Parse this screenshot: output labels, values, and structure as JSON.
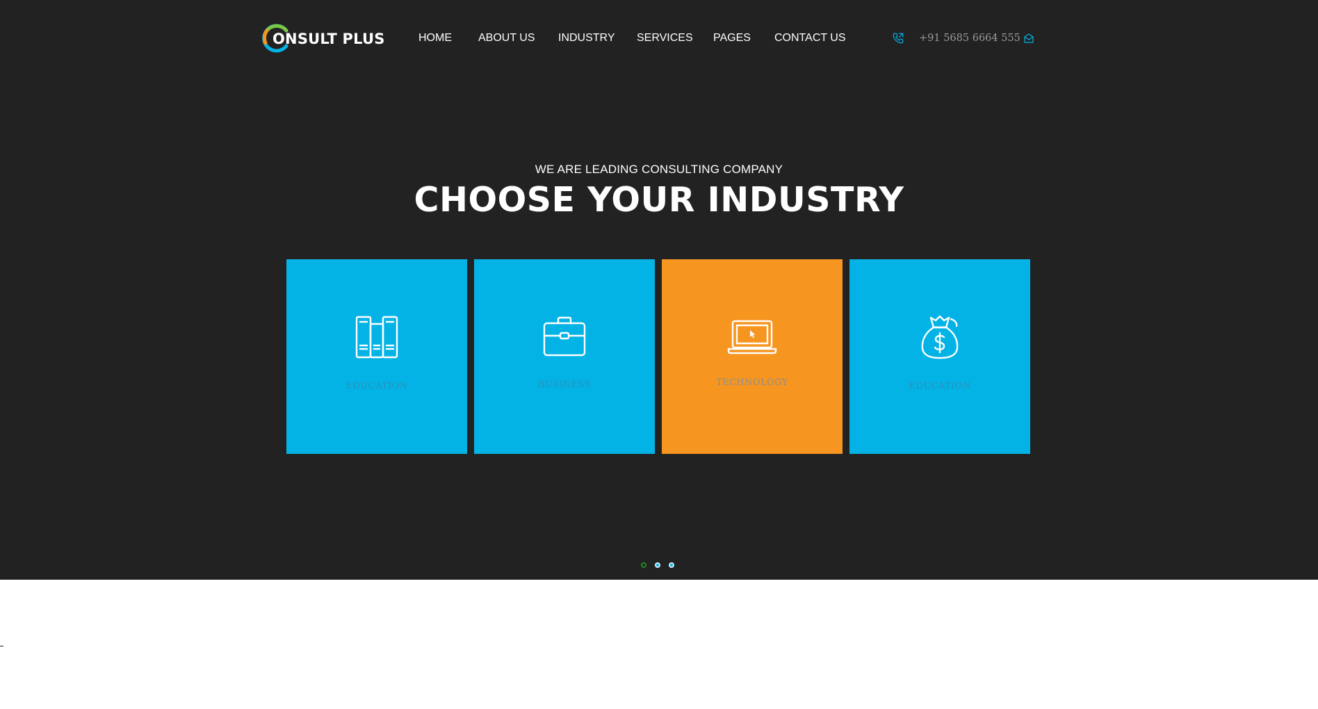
{
  "brand": {
    "name": "ONSULT PLUS",
    "logo_letter": "C",
    "colors": [
      "#f6951f",
      "#04b3e6",
      "#7ac943"
    ]
  },
  "nav": {
    "items": [
      {
        "label": "HOME"
      },
      {
        "label": "ABOUT US"
      },
      {
        "label": "INDUSTRY"
      },
      {
        "label": "SERVICES"
      },
      {
        "label": "PAGES"
      },
      {
        "label": "CONTACT US"
      }
    ]
  },
  "contact": {
    "phone_icon": "phone-icon",
    "phone": "+91 5685 6664 555",
    "mail_icon": "mail-icon"
  },
  "hero": {
    "subtitle": "WE ARE LEADING CONSULTING COMPANY",
    "title": "CHOOSE YOUR INDUSTRY",
    "background": "#222222"
  },
  "cards": [
    {
      "label": "EDUCATION",
      "icon": "books-icon",
      "color": "#04b3e6",
      "active": false
    },
    {
      "label": "BUSINESS",
      "icon": "briefcase-icon",
      "color": "#04b3e6",
      "active": false
    },
    {
      "label": "TECHNOLOGY",
      "icon": "laptop-icon",
      "color": "#f6951f",
      "active": true
    },
    {
      "label": "EDUCATION",
      "icon": "money-bag-icon",
      "color": "#04b3e6",
      "active": false
    }
  ],
  "slider": {
    "dots": 3,
    "active_index": 1
  }
}
